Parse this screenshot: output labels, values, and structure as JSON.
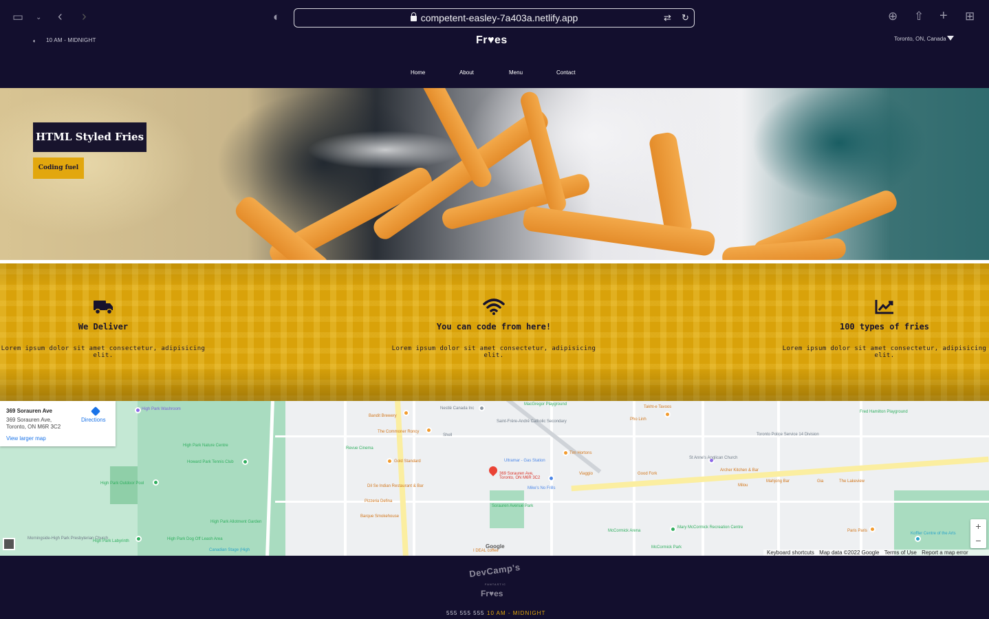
{
  "browser": {
    "url": "competent-easley-7a403a.netlify.app"
  },
  "header": {
    "hours": "10 AM - MIDNIGHT",
    "logo": "Fr♥es",
    "location": "Toronto, ON, Canada",
    "nav": [
      "Home",
      "About",
      "Menu",
      "Contact"
    ]
  },
  "hero": {
    "title": "HTML Styled Fries",
    "button": "Coding fuel"
  },
  "features": [
    {
      "icon": "truck-icon",
      "title": "We Deliver",
      "text": "Lorem ipsum dolor sit amet consectetur, adipisicing elit."
    },
    {
      "icon": "wifi-icon",
      "title": "You can code from here!",
      "text": "Lorem ipsum dolor sit amet consectetur, adipisicing elit."
    },
    {
      "icon": "chart-line-icon",
      "title": "100 types of fries",
      "text": "Lorem ipsum dolor sit amet consectetur, adipisicing elit."
    }
  ],
  "map": {
    "card_title": "369 Sorauren Ave",
    "card_address_1": "369 Sorauren Ave,",
    "card_address_2": "Toronto, ON M6R 3C2",
    "directions": "Directions",
    "view_larger": "View larger map",
    "marker_label": "369 Sorauren Ave, Toronto, ON M6R 3C2",
    "footer": {
      "shortcuts": "Keyboard shortcuts",
      "data": "Map data ©2022 Google",
      "terms": "Terms of Use",
      "report": "Report a map error"
    },
    "google": "Google",
    "labels": [
      "High Park Washroom",
      "Bandit Brewery",
      "The Commoner Roncy",
      "Shell",
      "Nestlé Canada Inc",
      "MacGregor Playground",
      "Saint-Frère-André Catholic Secondary",
      "Takht-e Tavoos",
      "Pho Linh",
      "Fred Hamilton Playground",
      "Toronto Police Service 14 Division",
      "High Park Nature Centre",
      "Revue Cinema",
      "Gold Standard",
      "Ultramar - Gas Station",
      "Tim Hortons",
      "Howard Park Tennis Club",
      "Viaggio",
      "Good Fork",
      "St Anne's Anglican Church",
      "Archer Kitchen & Bar",
      "High Park Outdoor Pool",
      "Dil Se Indian Restaurant & Bar",
      "Mike's No Frills",
      "Milou",
      "Mahjong Bar",
      "Gia",
      "The Lakeview",
      "Pizzeria Defina",
      "Sorauren Avenue Park",
      "Barque Smokehouse",
      "High Park Allotment Garden",
      "McCormick Arena",
      "Mary McCormick Recreation Centre",
      "Paris Paris",
      "Koffler Centre of the Arts",
      "Morningside-High Park Presbyterian Church",
      "High Park Labyrinth",
      "High Park Dog Off Leash Area",
      "Canadian Stage (High",
      "I DEAL coffee",
      "McCormick Park"
    ]
  },
  "footer": {
    "devcamp": "DevCamp's",
    "fantastic": "FANTASTIC",
    "logo": "Fr♥es",
    "phone": "555 555 555",
    "hours": "10 AM - MIDNIGHT"
  },
  "colors": {
    "navy": "#130f2e",
    "gold": "#e2a70e",
    "feature_bg": "#d9a20a"
  }
}
